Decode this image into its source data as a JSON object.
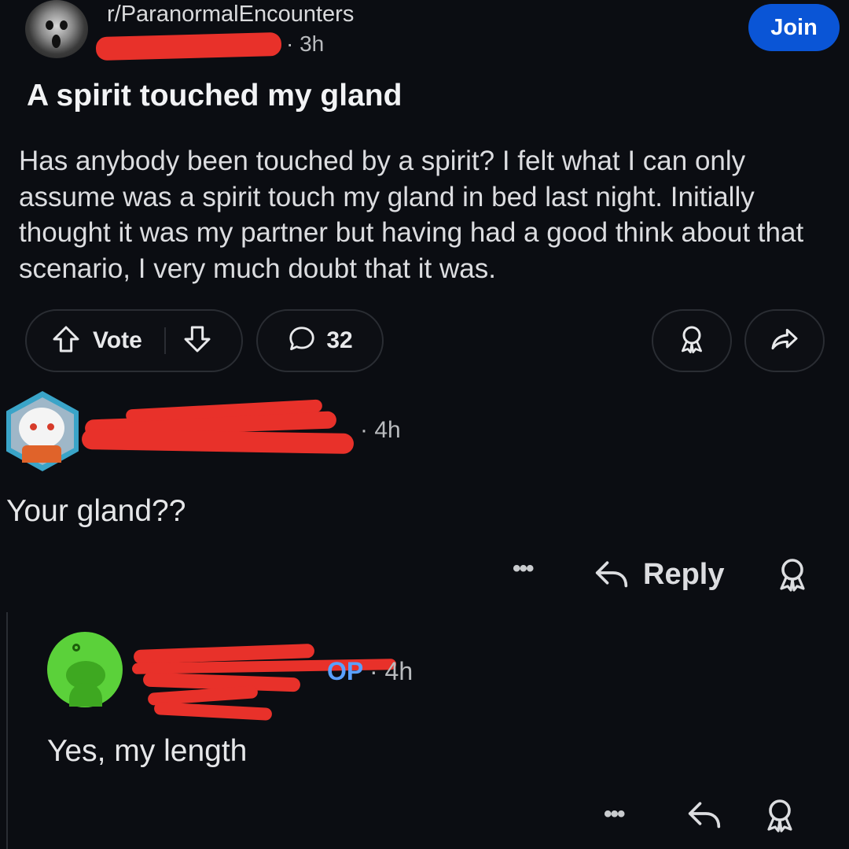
{
  "post": {
    "subreddit": "r/ParanormalEncounters",
    "time": "· 3h",
    "join_label": "Join",
    "title": "A spirit touched my gland",
    "body": "Has anybody been touched by a spirit? I felt what I can only assume was a spirit touch my gland in bed last night. Initially thought it was my partner but having had a good think about that scenario, I very much doubt that it was.",
    "vote_label": "Vote",
    "comment_count": "32"
  },
  "comments": [
    {
      "time": "· 4h",
      "text": "Your gland??",
      "more_label": "•••",
      "reply_label": "Reply"
    },
    {
      "op_tag": "OP",
      "time": "· 4h",
      "text": "Yes, my length",
      "more_label": "•••"
    }
  ],
  "colors": {
    "background": "#0b0d12",
    "join_button": "#0a55d6",
    "op_tag": "#5aa0ff",
    "redaction": "#e8312a"
  }
}
